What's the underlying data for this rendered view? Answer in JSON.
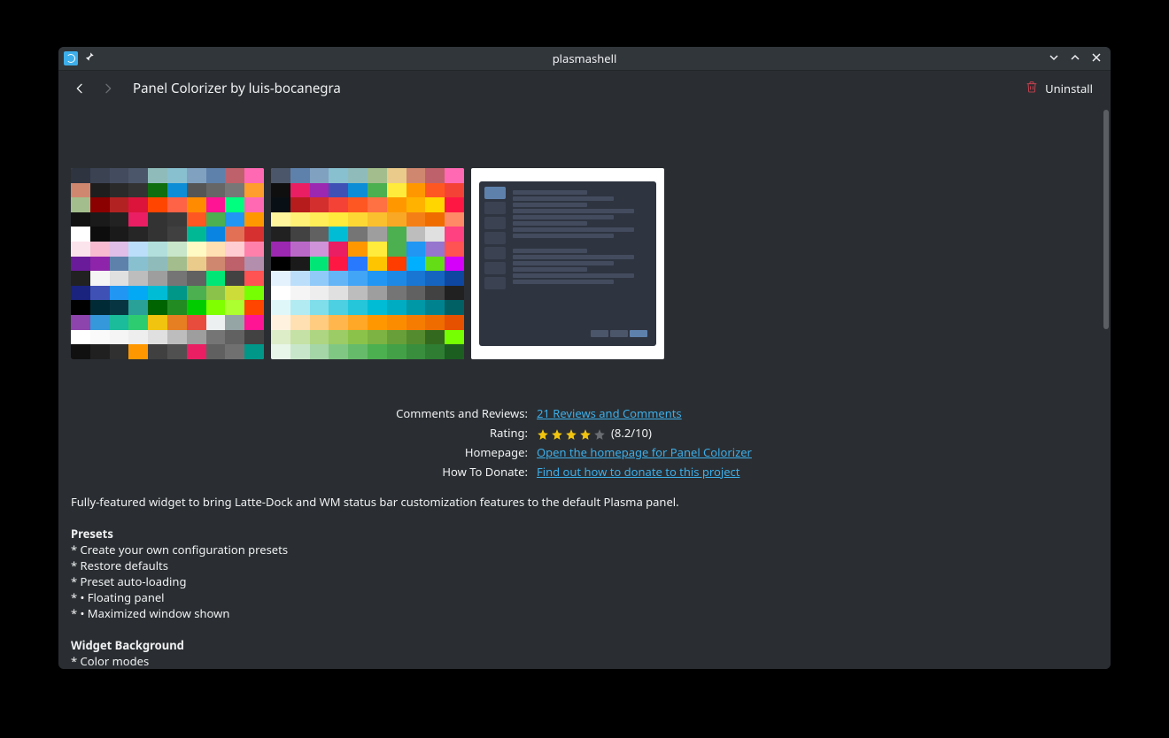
{
  "titlebar": {
    "title": "plasmashell"
  },
  "toolbar": {
    "page_title": "Panel Colorizer by luis-bocanegra",
    "uninstall_label": "Uninstall"
  },
  "meta": {
    "reviews_label": "Comments and Reviews:",
    "reviews_link": "21 Reviews and Comments",
    "rating_label": "Rating:",
    "rating_value": "(8.2/10)",
    "rating_stars_filled": 4,
    "rating_stars_total": 5,
    "homepage_label": "Homepage:",
    "homepage_link": "Open the homepage for Panel Colorizer",
    "donate_label": "How To Donate:",
    "donate_link": "Find out how to donate to this project"
  },
  "description": {
    "intro": "Fully-featured widget to bring Latte-Dock and WM status bar customization features to the default Plasma panel.",
    "section1_heading": "Presets",
    "section1_items": [
      "* Create your own configuration presets",
      "* Restore defaults",
      "* Preset auto-loading",
      "* • Floating panel",
      "* • Maximized window shown"
    ],
    "section2_heading": "Widget Background",
    "section2_items": [
      "* Color modes"
    ]
  }
}
